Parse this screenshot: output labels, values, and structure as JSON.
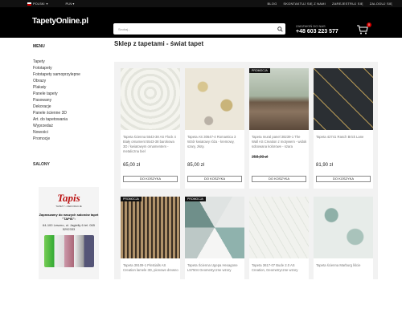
{
  "topbar": {
    "language": "POLSKI",
    "currency": "PLN",
    "links": [
      "BLOG",
      "SKONTAKTUJ SIĘ Z NAMI",
      "ZAREJESTRUJ SIĘ",
      "ZALOGUJ SIĘ"
    ]
  },
  "header": {
    "logo": "TapetyOnline.pl",
    "search_placeholder": "Szukaj...",
    "phone_caption": "ZADZWOŃ DO NAS",
    "phone": "+48 603 223 577",
    "cart_count": "0"
  },
  "sidebar": {
    "menu_title": "MENU",
    "items": [
      "Tapety",
      "Fototapety",
      "Fototapety samoprzylepne",
      "Obrazy",
      "Plakaty",
      "Panele tapety",
      "Pasowany",
      "Dekoracje",
      "Panele ścienne 3D",
      "Art. do tapetowania",
      "Wyprzedaż",
      "Nowości",
      "Promocje"
    ],
    "salons_title": "SALONY",
    "promo": {
      "brand": "Tapis",
      "brand_sub": "TAPETY • DEKORACJE",
      "text": "Zapraszamy do naszych salonów tapet \"TAPIS\":",
      "address": "64-100 Leszno, ul. Jagiełły 6 tel. 065 5292333"
    }
  },
  "main": {
    "title": "Sklep z tapetami - świat tapet",
    "buy_label": "DO KOSZYKA",
    "products": [
      {
        "name": "Tapeta ścienna 5543-38 AS Flock 4 Biały ornament 5543-38 barokowa 3D / kwiatowym ornamentem - metaliczna biel",
        "price": "65,00 zł",
        "old_price": "",
        "promo": ""
      },
      {
        "name": "Tapeta AS 30647-4 Romantica 3 Wzór kwiatowy róża - kremowy, szary, złoty.",
        "price": "85,00 zł",
        "old_price": "",
        "promo": ""
      },
      {
        "name": "Tapeta mural panel 38239-1 The Wall AS Creation z motywem - widok sobowana kolorowe - szara",
        "price": "258,00 zł",
        "old_price": "258,00 zł",
        "promo": "PROMOCJA"
      },
      {
        "name": "Tapeta 42741 Rasch Brick Lane",
        "price": "81,90 zł",
        "old_price": "",
        "promo": ""
      },
      {
        "name": "Tapeta 39109-1 Pinstialls AS Creation lamele 3D, pionowe drewno",
        "price": "",
        "old_price": "",
        "promo": "PROMOCJA"
      },
      {
        "name": "Tapeta Ścienna Ugepa Hexagone L57504 Geometryczne wzory",
        "price": "",
        "old_price": "",
        "promo": "PROMOCJA"
      },
      {
        "name": "Tapeta 3617-07 Bude 2.0 AS Creation, Geometryczne wzory",
        "price": "",
        "old_price": "",
        "promo": ""
      },
      {
        "name": "Tapeta ścienna Marburg liście",
        "price": "",
        "old_price": "",
        "promo": ""
      }
    ]
  }
}
